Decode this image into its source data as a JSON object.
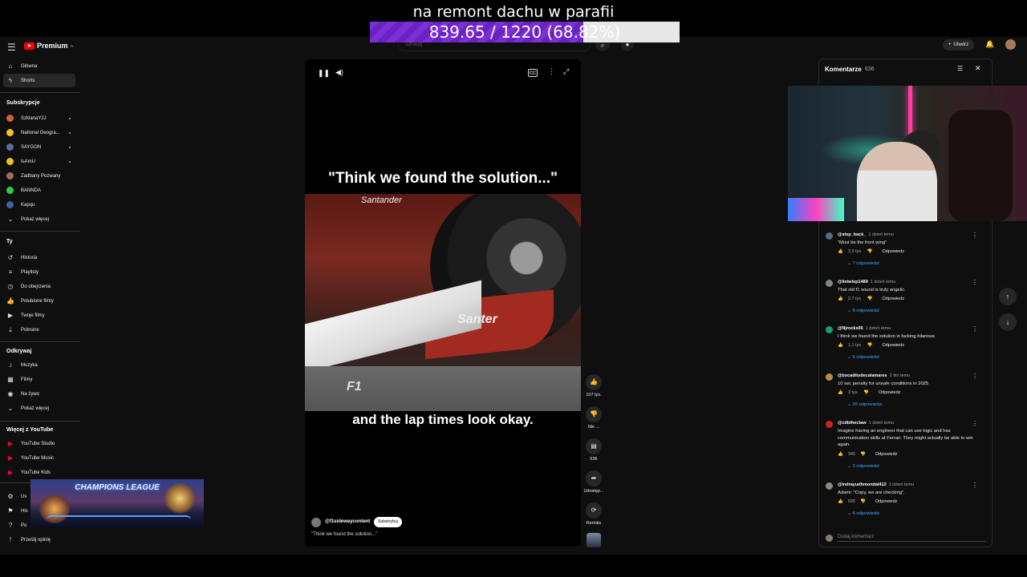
{
  "overlay": {
    "donation_title": "na remont dachu w parafii",
    "goal_text": "839.65 / 1220 (68.82%)",
    "goal_progress": 0.6882
  },
  "topbar": {
    "logo_text": "Premium",
    "logo_country": "PL",
    "search_placeholder": "Szukaj",
    "create_label": "Utwórz"
  },
  "sidebar": {
    "main": [
      {
        "label": "Główna",
        "icon": "home-icon"
      },
      {
        "label": "Shorts",
        "icon": "shorts-icon"
      }
    ],
    "subs_heading": "Subskrypcje",
    "subs": [
      {
        "label": "SzklanaY2J",
        "color": "#d06030",
        "dot": true
      },
      {
        "label": "National Geogra...",
        "color": "#f5c518",
        "dot": true
      },
      {
        "label": "SAYGON",
        "color": "#5a6aa0",
        "dot": true
      },
      {
        "label": "IsAmU",
        "color": "#f0c020",
        "dot": true
      },
      {
        "label": "Zadbany Pozwany",
        "color": "#a07050",
        "dot": false
      },
      {
        "label": "BANNDA",
        "color": "#2ecc40",
        "dot": false
      },
      {
        "label": "Kapqu",
        "color": "#4060a0",
        "dot": false
      }
    ],
    "show_more": "Pokaż więcej",
    "you_heading": "Ty",
    "you": [
      {
        "label": "Historia",
        "icon": "history-icon"
      },
      {
        "label": "Playlisty",
        "icon": "playlist-icon"
      },
      {
        "label": "Do obejrzenia",
        "icon": "watch-later-icon"
      },
      {
        "label": "Polubione filmy",
        "icon": "liked-icon"
      },
      {
        "label": "Twoje filmy",
        "icon": "your-videos-icon"
      },
      {
        "label": "Pobrane",
        "icon": "download-icon"
      }
    ],
    "explore_heading": "Odkrywaj",
    "explore": [
      {
        "label": "Muzyka",
        "icon": "music-icon"
      },
      {
        "label": "Filmy",
        "icon": "film-icon"
      },
      {
        "label": "Na żywo",
        "icon": "live-icon"
      },
      {
        "label": "Pokaż więcej",
        "icon": "chevron-down-icon"
      }
    ],
    "more_heading": "Więcej z YouTube",
    "more": [
      {
        "label": "YouTube Studio"
      },
      {
        "label": "YouTube Music"
      },
      {
        "label": "YouTube Kids"
      }
    ],
    "bottom": [
      {
        "label": "Us",
        "icon": "settings-icon"
      },
      {
        "label": "His",
        "icon": "flag-icon"
      },
      {
        "label": "Po",
        "icon": "help-icon"
      },
      {
        "label": "Prześlij opinię",
        "icon": "feedback-icon"
      }
    ],
    "champions_text": "CHAMPIONS LEAGUE"
  },
  "video": {
    "caption_top": "\"Think we found the solution...\"",
    "caption_bottom": "and the lap times look okay.",
    "frame_brand_top": "Santander",
    "frame_brand_wing": "Santer",
    "frame_logo": "F1",
    "channel": "@f1sidewaycontent",
    "subscribe": "Subskrybuj",
    "description": "\"Think we found the solution...\""
  },
  "actions": {
    "like": "107 tys.",
    "dislike": "Nie ...",
    "comments": "636",
    "share": "Udostęp...",
    "remix": "Remiks"
  },
  "comments_panel": {
    "title": "Komentarze",
    "count": "636",
    "reply_label": "Odpowiedz",
    "add_comment": "Dodaj komentarz",
    "items": [
      {
        "author": "@step_back_",
        "time": "1 dzień temu",
        "text": "\"Must be the front wing\"",
        "likes": "3,9 tys.",
        "replies": "7 odpowiedzi",
        "color": "#5a6a8a"
      },
      {
        "author": "@lietwiep1489",
        "time": "1 dzień temu",
        "text": "That old f1 sound is truly angelic.",
        "likes": "2,7 tys.",
        "replies": "8 odpowiedzi",
        "color": "#7a8a7a"
      },
      {
        "author": "@Njrocks06",
        "time": "1 dzień temu",
        "text": "I think we found the solution is fucking hilarious",
        "likes": "1,1 tys.",
        "replies": "6 odpowiedzi",
        "color": "#1a9a7a"
      },
      {
        "author": "@bocaditodecalamares",
        "time": "2 dni temu",
        "text": "10 sec penalty for unsafe conditions in 2025",
        "likes": "3 tys.",
        "replies": "20 odpowiedzi",
        "color": "#c08a3a"
      },
      {
        "author": "@cdbthectaw",
        "time": "1 dzień temu",
        "text": "Imagine having an engineer that can use logic and has communication skills at Ferrari. They might actually be able to win again.",
        "likes": "345",
        "replies": "3 odpowiedzi",
        "color": "#d02020"
      },
      {
        "author": "@indrayudhmondal412",
        "time": "1 dzień temu",
        "text": "Adami: \"Copy, we are checking\".",
        "likes": "695",
        "replies": "4 odpowiedzi",
        "color": "#8a8a7a"
      }
    ]
  }
}
